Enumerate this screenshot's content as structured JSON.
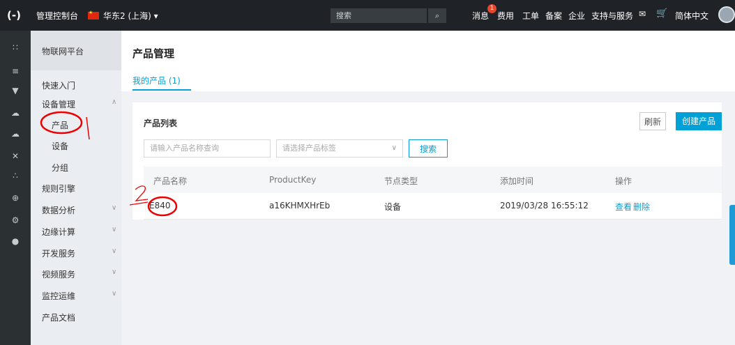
{
  "header": {
    "logo_icon": "aliyun-logo-icon",
    "console_title": "管理控制台",
    "region": "华东2 (上海) ▾",
    "search_placeholder": "搜索",
    "search_icon": "search-icon",
    "nav": [
      "消息",
      "费用",
      "工单",
      "备案",
      "企业",
      "支持与服务",
      "简体中文"
    ],
    "message_badge": "1",
    "colors": {
      "bg": "#1f2327",
      "badge": "#e5462f"
    }
  },
  "sidebar": {
    "section_title": "物联网平台",
    "items": [
      {
        "label": "快速入门"
      },
      {
        "label": "设备管理",
        "expanded": true,
        "chevron": "chevron-up-icon"
      },
      {
        "label": "产品",
        "sub": true,
        "selected": true
      },
      {
        "label": "设备",
        "sub": true
      },
      {
        "label": "分组",
        "sub": true
      },
      {
        "label": "规则引擎"
      },
      {
        "label": "数据分析",
        "chevron": "chevron-down-icon"
      },
      {
        "label": "边缘计算",
        "chevron": "chevron-down-icon"
      },
      {
        "label": "开发服务",
        "chevron": "chevron-down-icon"
      },
      {
        "label": "视频服务",
        "chevron": "chevron-down-icon"
      },
      {
        "label": "监控运维",
        "chevron": "chevron-down-icon"
      },
      {
        "label": "产品文档"
      }
    ]
  },
  "main": {
    "page_title": "产品管理",
    "tab_label": "我的产品 (1)",
    "card_title": "产品列表",
    "refresh_label": "刷新",
    "create_label": "创建产品",
    "name_placeholder": "请输入产品名称查询",
    "tag_placeholder": "请选择产品标签",
    "search_label": "搜索",
    "table": {
      "headers": [
        "产品名称",
        "ProductKey",
        "节点类型",
        "添加时间",
        "操作"
      ],
      "rows": [
        {
          "name": "E840",
          "key": "a16KHMXHrEb",
          "node_type": "设备",
          "added": "2019/03/28 16:55:12",
          "view": "查看",
          "delete": "删除"
        }
      ]
    },
    "accent_color": "#00a1d6"
  }
}
